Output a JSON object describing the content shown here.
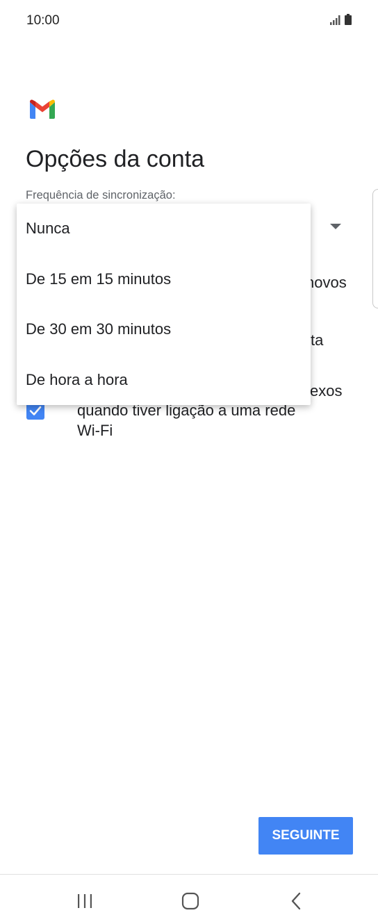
{
  "status_bar": {
    "time": "10:00"
  },
  "page": {
    "title": "Opções da conta",
    "sync_label": "Frequência de sincronização:"
  },
  "background_fragments": {
    "line1": "novos",
    "line2": "ta",
    "line3": "exos",
    "line4": "quando tiver ligação a uma rede",
    "line5": "Wi-Fi"
  },
  "dropdown": {
    "options": [
      "Nunca",
      "De 15 em 15 minutos",
      "De 30 em 30 minutos",
      "De hora a hora"
    ]
  },
  "footer": {
    "next_label": "SEGUINTE"
  },
  "colors": {
    "accent": "#4285f4",
    "text": "#202124",
    "secondary_text": "#5f6368"
  },
  "icons": {
    "logo": "gmail-logo",
    "nav": [
      "recent-apps-icon",
      "home-icon",
      "back-icon"
    ]
  }
}
